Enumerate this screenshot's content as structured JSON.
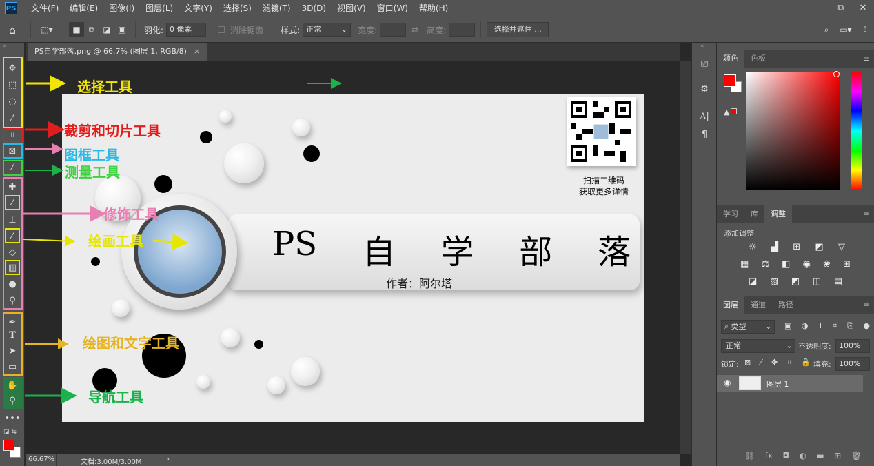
{
  "app": {
    "name": "PS",
    "menus": [
      "文件(F)",
      "编辑(E)",
      "图像(I)",
      "图层(L)",
      "文字(Y)",
      "选择(S)",
      "滤镜(T)",
      "3D(D)",
      "视图(V)",
      "窗口(W)",
      "帮助(H)"
    ]
  },
  "window_controls": [
    "—",
    "⧉",
    "✕"
  ],
  "options": {
    "feather_label": "羽化:",
    "feather_value": "0 像素",
    "antialias_label": "消除锯齿",
    "style_label": "样式:",
    "style_value": "正常",
    "width_label": "宽度:",
    "height_label": "高度:",
    "select_mask_button": "选择并遮住 ..."
  },
  "document": {
    "tab_title": "PS自学部落.png @ 66.7% (图层 1, RGB/8)",
    "zoom": "66.67%",
    "doc_info": "文档:3.00M/3.00M"
  },
  "canvas": {
    "title_ps": "PS",
    "title_chars": [
      "自",
      "学",
      "部",
      "落"
    ],
    "author": "作者：阿尔塔",
    "qr_caption_1": "扫描二维码",
    "qr_caption_2": "获取更多详情"
  },
  "annotations": {
    "select": "选择工具",
    "crop": "裁剪和切片工具",
    "frame": "图框工具",
    "measure": "测量工具",
    "retouch": "修饰工具",
    "paint": "绘画工具",
    "draw_text": "绘图和文字工具",
    "nav": "导航工具"
  },
  "colors": {
    "select": "#f2e600",
    "crop": "#e11d1d",
    "frame": "#29b9e6",
    "measure": "#3fd13f",
    "retouch": "#e87fb2",
    "paint": "#e6e600",
    "draw_text": "#e6b422",
    "nav": "#19b24b",
    "fg": "#ff0000",
    "bg": "#ffffff"
  },
  "color_panel": {
    "tabs": [
      "颜色",
      "色板"
    ]
  },
  "adjust_panel": {
    "tabs": [
      "学习",
      "库",
      "调整"
    ],
    "add_label": "添加调整"
  },
  "layers_panel": {
    "tabs": [
      "图层",
      "通道",
      "路径"
    ],
    "filter_label": "类型",
    "blend_mode": "正常",
    "opacity_label": "不透明度:",
    "opacity_value": "100%",
    "lock_label": "锁定:",
    "fill_label": "填充:",
    "fill_value": "100%",
    "layer_name": "图层 1"
  }
}
